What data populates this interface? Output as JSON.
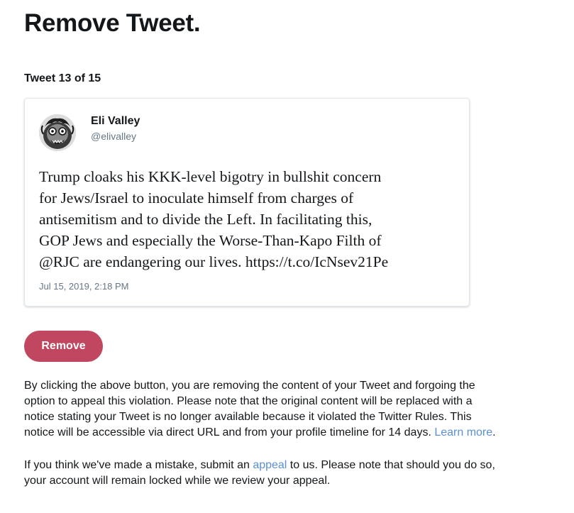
{
  "page": {
    "title": "Remove Tweet.",
    "counter": "Tweet 13 of 15"
  },
  "tweet": {
    "author_name": "Eli Valley",
    "author_handle": "@elivalley",
    "text_lines": [
      "Trump cloaks his KKK-level bigotry in bullshit concern",
      "for Jews/Israel to inoculate himself from charges of",
      "antisemitism and to divide the Left. In facilitating this,",
      "GOP Jews and especially the Worse-Than-Kapo Filth of",
      "@RJC are endangering our lives. https://t.co/IcNsev21Pe"
    ],
    "timestamp": "Jul 15, 2019, 2:18 PM",
    "avatar_icon": "avatar-illustration-icon"
  },
  "actions": {
    "remove_label": "Remove"
  },
  "notice": {
    "lines": [
      "By clicking the above button, you are removing the content of your Tweet and forgoing the",
      "option to appeal this violation. Please note that the original content will be replaced with a",
      "notice stating your Tweet is no longer available because it violated the Twitter Rules. This",
      "notice will be accessible via direct URL and from your profile timeline for 14 days. "
    ],
    "learn_more_label": "Learn more",
    "learn_more_suffix": "."
  },
  "appeal_info": {
    "line1_prefix": "If you think we've made a mistake, submit an ",
    "appeal_link_label": "appeal",
    "line1_suffix": " to us. Please note that should you do so,",
    "line2": "your account will remain locked while we review your appeal."
  },
  "colors": {
    "remove_button": "#c0475f",
    "link": "#5b8fd4",
    "secondary_text": "#657786",
    "card_border": "#e1e8ed"
  }
}
